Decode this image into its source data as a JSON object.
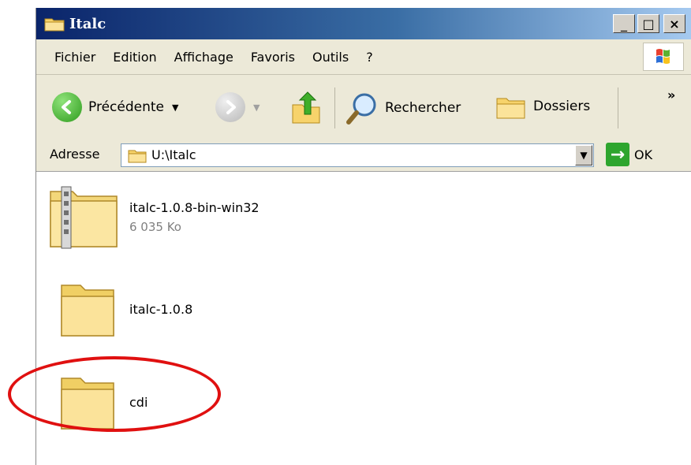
{
  "window": {
    "title": "Italc",
    "minimize": "_",
    "maximize": "□",
    "close": "×"
  },
  "menu": [
    "Fichier",
    "Edition",
    "Affichage",
    "Favoris",
    "Outils",
    "?"
  ],
  "toolbar": {
    "back_label": "Précédente",
    "search_label": "Rechercher",
    "folders_label": "Dossiers",
    "more": "»"
  },
  "address": {
    "label": "Adresse",
    "value": "U:\\Italc",
    "go_label": "OK"
  },
  "files": [
    {
      "name": "italc-1.0.8-bin-win32",
      "size": "6 035 Ko",
      "type": "zip-folder"
    },
    {
      "name": "italc-1.0.8",
      "type": "folder"
    },
    {
      "name": "cdi",
      "type": "folder"
    }
  ],
  "annotation": {
    "color": "#e01010",
    "target": "cdi"
  }
}
